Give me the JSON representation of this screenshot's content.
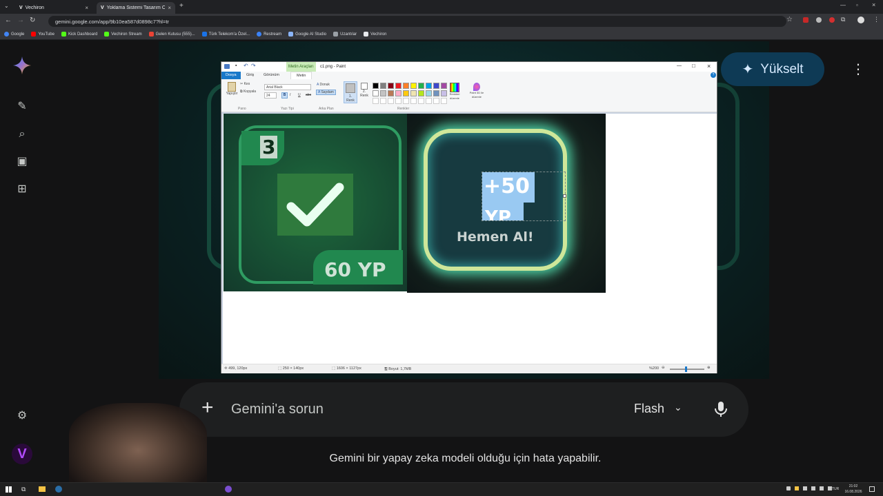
{
  "browser": {
    "tabs": [
      {
        "title": "Vechiron",
        "active": false
      },
      {
        "title": "Yoklama Sistemi Tasarım Öneri...",
        "active": true
      }
    ],
    "url": "gemini.google.com/app/9b10ea587d0898c7?hl=tr",
    "bookmarks": [
      {
        "label": "Google",
        "color": "#4285f4"
      },
      {
        "label": "YouTube",
        "color": "#ff0000"
      },
      {
        "label": "Kick Dashboard",
        "color": "#53fc18"
      },
      {
        "label": "Vechiron Stream",
        "color": "#53fc18"
      },
      {
        "label": "Gelen Kutusu (555)...",
        "color": "#ea4335"
      },
      {
        "label": "Türk Telekom'a Özel...",
        "color": "#1a73e8"
      },
      {
        "label": "Restream",
        "color": "#3b82f6"
      },
      {
        "label": "Google AI Studio",
        "color": "#8ab4f8"
      },
      {
        "label": "Uzantılar",
        "color": "#9aa0a6"
      },
      {
        "label": "Vechiron",
        "color": "#e8eaed"
      }
    ]
  },
  "gemini": {
    "upgrade_label": "Yükselt",
    "ask_placeholder": "Gemini'a sorun",
    "model_label": "Flash",
    "disclaimer": "Gemini bir yapay zeka modeli olduğu için hata yapabilir."
  },
  "paint": {
    "window_title": "c1.png - Paint",
    "context_tab": "Metin Araçları",
    "tabs": [
      "Dosya",
      "Giriş",
      "Görünüm",
      "Metin"
    ],
    "clipboard": {
      "paste": "Yapıştır",
      "cut": "Kes",
      "copy": "Kopyala",
      "group": "Pano"
    },
    "font": {
      "name": "Arial Black",
      "size": "24",
      "group": "Yazı Tipi"
    },
    "background": {
      "opaque": "Donuk",
      "transparent": "Saydam",
      "group": "Arka Plan"
    },
    "colors": {
      "color1": "1.\nRenk",
      "color2": "2.\nRenk",
      "edit": "Renkleri düzenle",
      "paint3d": "Paint 3D ile düzenle",
      "group": "Renkler"
    },
    "palette": [
      "#000000",
      "#7f7f7f",
      "#880015",
      "#ed1c24",
      "#ff7f27",
      "#fff200",
      "#22b14c",
      "#00a2e8",
      "#3f48cc",
      "#a349a4",
      "#ffffff",
      "#c3c3c3",
      "#b97a57",
      "#ffaec9",
      "#ffc90e",
      "#efe4b0",
      "#b5e61d",
      "#99d9ea",
      "#7092be",
      "#c8bfe7"
    ],
    "image": {
      "left_number": "3",
      "left_points": "60 YP",
      "right_text": "+50",
      "right_text2": "YP",
      "right_button": "Hemen Al!"
    },
    "status": {
      "cursor": "499, 120px",
      "selection": "250 × 140px",
      "size": "1606 × 1127px",
      "filesize": "Boyut: 1,7MB",
      "zoom": "%200"
    }
  },
  "taskbar": {
    "lang": "TUR",
    "time": "21:02",
    "date": "16.08.2026"
  }
}
